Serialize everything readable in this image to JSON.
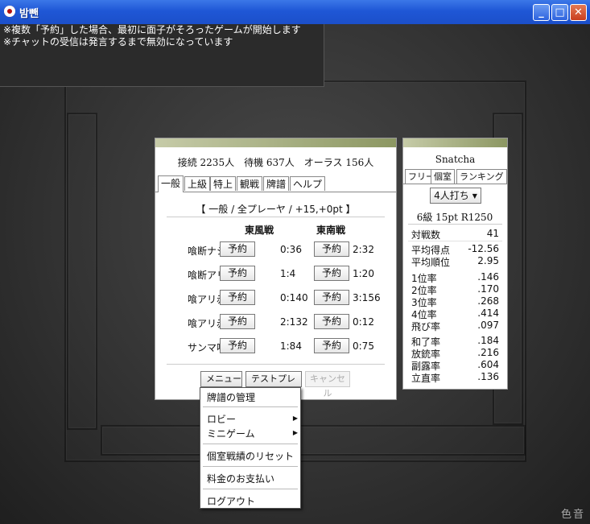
{
  "window": {
    "title": "밤뺀",
    "min": "_",
    "max": "□",
    "close": "✕"
  },
  "chat": {
    "lines": [
      "※複数「予約」した場合、最初に面子がそろったゲームが開始します",
      "※チャットの受信は発言するまで無効になっています"
    ]
  },
  "lobby": {
    "stats": "接続 2235人　待機 637人　オーラス 156人",
    "tabs": [
      "一般",
      "上級",
      "特上",
      "観戦",
      "牌譜",
      "ヘルプ"
    ],
    "mode_title": "【 一般 / 全プレーヤ / +15,+0pt 】",
    "col_east": "東風戦",
    "col_south": "東南戦",
    "reserve": "予約",
    "rows": [
      {
        "label": "喰断ナシ",
        "east": "0:36",
        "south": "2:32"
      },
      {
        "label": "喰断アリ",
        "east": "1:4",
        "south": "1:20"
      },
      {
        "label": "喰アリ赤",
        "east": "0:140",
        "south": "3:156"
      },
      {
        "label": "喰アリ赤速",
        "east": "2:132",
        "south": "0:12"
      },
      {
        "label": "サンマ喰赤",
        "east": "1:84",
        "south": "0:75"
      }
    ],
    "menu_btn": "メニュー",
    "test_btn": "テストプレイ",
    "cancel_btn": "キャンセル"
  },
  "profile": {
    "name": "Snatcha",
    "tabs": [
      "フリー",
      "個室",
      "ランキング"
    ],
    "mode": "4人打ち",
    "rank": "6級 15pt R1250",
    "stats": [
      {
        "label": "対戦数",
        "value": "41"
      },
      {
        "label": "平均得点",
        "value": "-12.56"
      },
      {
        "label": "平均順位",
        "value": "2.95"
      },
      {
        "label": "1位率",
        "value": ".146"
      },
      {
        "label": "2位率",
        "value": ".170"
      },
      {
        "label": "3位率",
        "value": ".268"
      },
      {
        "label": "4位率",
        "value": ".414"
      },
      {
        "label": "飛び率",
        "value": ".097"
      },
      {
        "label": "和了率",
        "value": ".184"
      },
      {
        "label": "放銃率",
        "value": ".216"
      },
      {
        "label": "副露率",
        "value": ".604"
      },
      {
        "label": "立直率",
        "value": ".136"
      }
    ]
  },
  "menu": {
    "items": [
      "牌譜の管理",
      "ロビー",
      "ミニゲーム",
      "個室戦績のリセット",
      "料金のお支払い",
      "ログアウト"
    ]
  },
  "brand": "色音"
}
